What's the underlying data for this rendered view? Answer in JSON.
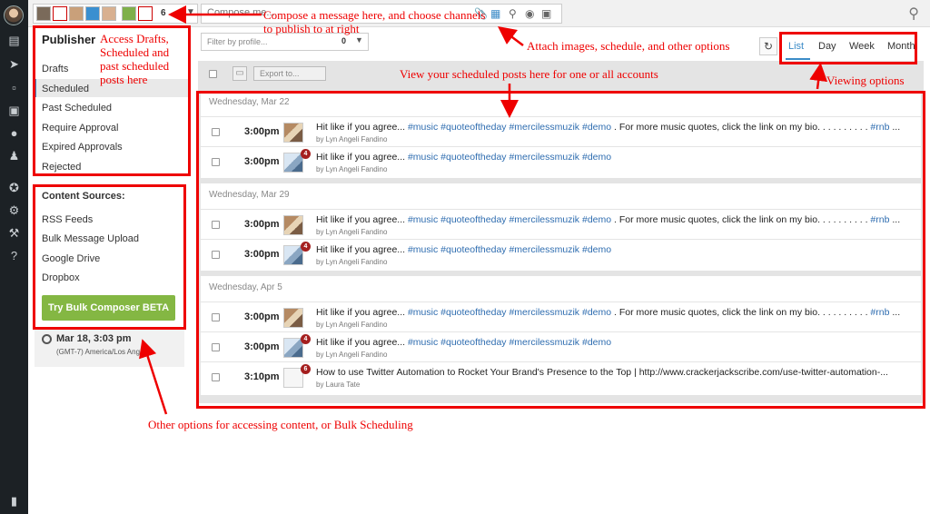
{
  "topbar": {
    "profile_count": "6",
    "compose_placeholder": "Compose me..."
  },
  "sidebar": {
    "title": "Publisher",
    "items": [
      {
        "label": "Drafts"
      },
      {
        "label": "Scheduled",
        "active": true
      },
      {
        "label": "Past Scheduled"
      },
      {
        "label": "Require Approval"
      },
      {
        "label": "Expired Approvals"
      },
      {
        "label": "Rejected"
      }
    ],
    "content_sources_title": "Content Sources:",
    "content_sources": [
      {
        "label": "RSS Feeds"
      },
      {
        "label": "Bulk Message Upload"
      },
      {
        "label": "Google Drive"
      },
      {
        "label": "Dropbox"
      }
    ],
    "bulk_button": "Try Bulk Composer BETA",
    "current_date": "Mar 18, 3:03 pm",
    "timezone": "(GMT-7) America/Los Angeles"
  },
  "filter": {
    "placeholder": "Filter by profile...",
    "count": "0"
  },
  "view_tabs": [
    {
      "label": "List",
      "active": true
    },
    {
      "label": "Day"
    },
    {
      "label": "Week"
    },
    {
      "label": "Month"
    }
  ],
  "bulkbar": {
    "export_label": "Export to..."
  },
  "days": [
    {
      "date": "Wednesday, Mar 22",
      "posts": [
        {
          "time": "3:00pm",
          "text": "Hit like if you agree... ",
          "tags": "#music #quoteoftheday #mercilessmuzik #demo",
          "rest": " . For more music quotes, click the link on my bio. . . . . . . . . . ",
          "tags2": "#rnb",
          "tail": " ...",
          "author": "by Lyn Angeli Fandino",
          "badge": ""
        },
        {
          "time": "3:00pm",
          "text": "Hit like if you agree... ",
          "tags": "#music #quoteoftheday #mercilessmuzik #demo",
          "rest": "",
          "tags2": "",
          "tail": "",
          "author": "by Lyn Angeli Fandino",
          "badge": "4"
        }
      ]
    },
    {
      "date": "Wednesday, Mar 29",
      "posts": [
        {
          "time": "3:00pm",
          "text": "Hit like if you agree... ",
          "tags": "#music #quoteoftheday #mercilessmuzik #demo",
          "rest": " . For more music quotes, click the link on my bio. . . . . . . . . . ",
          "tags2": "#rnb",
          "tail": " ...",
          "author": "by Lyn Angeli Fandino",
          "badge": ""
        },
        {
          "time": "3:00pm",
          "text": "Hit like if you agree... ",
          "tags": "#music #quoteoftheday #mercilessmuzik #demo",
          "rest": "",
          "tags2": "",
          "tail": "",
          "author": "by Lyn Angeli Fandino",
          "badge": "4"
        }
      ]
    },
    {
      "date": "Wednesday, Apr 5",
      "posts": [
        {
          "time": "3:00pm",
          "text": "Hit like if you agree... ",
          "tags": "#music #quoteoftheday #mercilessmuzik #demo",
          "rest": " . For more music quotes, click the link on my bio. . . . . . . . . . ",
          "tags2": "#rnb",
          "tail": " ...",
          "author": "by Lyn Angeli Fandino",
          "badge": ""
        },
        {
          "time": "3:00pm",
          "text": "Hit like if you agree... ",
          "tags": "#music #quoteoftheday #mercilessmuzik #demo",
          "rest": "",
          "tags2": "",
          "tail": "",
          "author": "by Lyn Angeli Fandino",
          "badge": "4"
        },
        {
          "time": "3:10pm",
          "text": "How to use Twitter Automation to Rocket Your Brand's Presence to the Top | http://www.crackerjackscribe.com/use-twitter-automation-...",
          "tags": "",
          "rest": "",
          "tags2": "",
          "tail": "",
          "author": "by Laura Tate",
          "badge": "6"
        }
      ]
    }
  ],
  "annotations": {
    "compose": "Compose a message here, and choose channels to publish to at right",
    "access": "Access Drafts, Scheduled and past scheduled posts here",
    "attach": "Attach images, schedule, and other options",
    "view_posts": "View your scheduled posts here for one or all accounts",
    "viewing_options": "Viewing options",
    "other_options": "Other options for accessing content, or Bulk Scheduling",
    "color": "#e00000"
  }
}
